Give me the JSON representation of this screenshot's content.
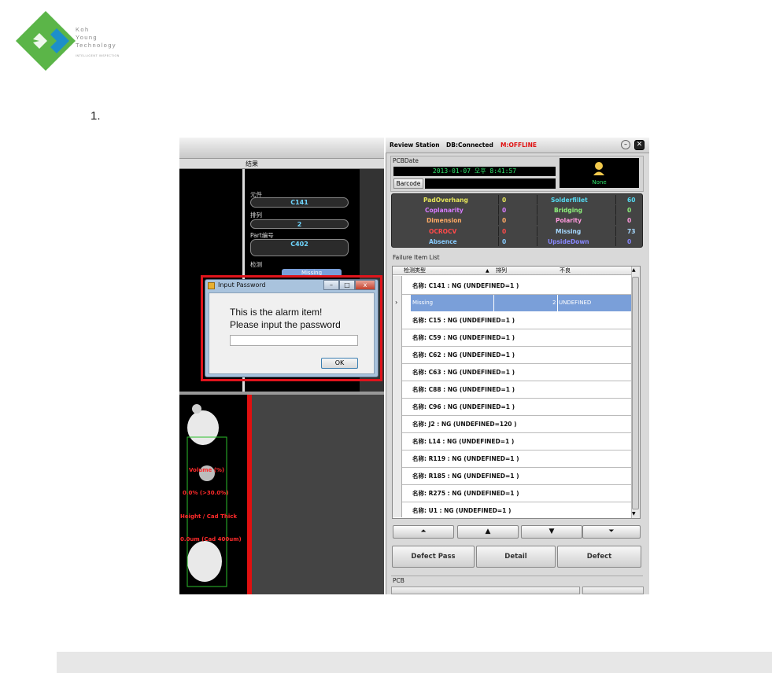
{
  "logo": {
    "lines": [
      "Koh",
      "Young",
      "Technology"
    ],
    "tagline": "INTELLIGENT INSPECTION"
  },
  "step_number": "1.",
  "left_panel": {
    "header_label": "结果",
    "fields": [
      {
        "label": "元件",
        "value": "C141"
      },
      {
        "label": "排列",
        "value": "2"
      },
      {
        "label": "Part编号",
        "value": "C402"
      },
      {
        "label": "检测",
        "value": "Missing"
      }
    ],
    "overlay": [
      "Volume (%)",
      "0.0% (>30.0%)",
      "Height / Cad Thick",
      "0.0um (Cad 400um)"
    ]
  },
  "dialog": {
    "title": "Input Password",
    "message_line1": "This is the alarm item!",
    "message_line2": "Please input the password",
    "password_value": "",
    "ok_label": "OK",
    "window_buttons": {
      "min": "–",
      "max": "□",
      "close": "x"
    }
  },
  "right_panel": {
    "title": "Review Station",
    "db_status": "DB:Connected",
    "mode_status": "M:OFFLINE",
    "pcb_date_label": "PCBDate",
    "pcb_date": "2013-01-07 오후 8:41:57",
    "barcode_button": "Barcode",
    "barcode_value": "",
    "user_name": "None",
    "stats": [
      {
        "l_name": "PadOverhang",
        "l_val": "0",
        "l_color": "#e6e65a",
        "r_name": "Solderfillet",
        "r_val": "60",
        "r_color": "#55d9f0"
      },
      {
        "l_name": "Coplanarity",
        "l_val": "0",
        "l_color": "#d77bff",
        "r_name": "Bridging",
        "r_val": "0",
        "r_color": "#8ef07b"
      },
      {
        "l_name": "Dimension",
        "l_val": "0",
        "l_color": "#ffaa66",
        "r_name": "Polarity",
        "r_val": "0",
        "r_color": "#ff99dd"
      },
      {
        "l_name": "OCROCV",
        "l_val": "0",
        "l_color": "#ff4a4a",
        "r_name": "Missing",
        "r_val": "73",
        "r_color": "#a6d8ff"
      },
      {
        "l_name": "Absence",
        "l_val": "0",
        "l_color": "#88ccff",
        "r_name": "UpsideDown",
        "r_val": "0",
        "r_color": "#8888ff"
      }
    ],
    "list_label": "Failure Item List",
    "columns": [
      "检测类型",
      "排列",
      "不良"
    ],
    "selected_row": {
      "type": "Missing",
      "array": "2",
      "result": "UNDEFINED"
    },
    "rows": [
      "名称: C141 : NG (UNDEFINED=1 )",
      "名称: C15 : NG (UNDEFINED=1 )",
      "名称: C59 : NG (UNDEFINED=1 )",
      "名称: C62 : NG (UNDEFINED=1 )",
      "名称: C63 : NG (UNDEFINED=1 )",
      "名称: C88 : NG (UNDEFINED=1 )",
      "名称: C96 : NG (UNDEFINED=1 )",
      "名称: J2 : NG (UNDEFINED=120 )",
      "名称: L14 : NG (UNDEFINED=1 )",
      "名称: R119 : NG (UNDEFINED=1 )",
      "名称: R185 : NG (UNDEFINED=1 )",
      "名称: R275 : NG (UNDEFINED=1 )",
      "名称: U1 : NG (UNDEFINED=1 )"
    ],
    "nav_buttons": [
      "⏶",
      "▲",
      "▼",
      "⏷"
    ],
    "buttons": {
      "defect_pass": "Defect Pass",
      "detail": "Detail",
      "defect": "Defect"
    },
    "pcb_label": "PCB"
  }
}
